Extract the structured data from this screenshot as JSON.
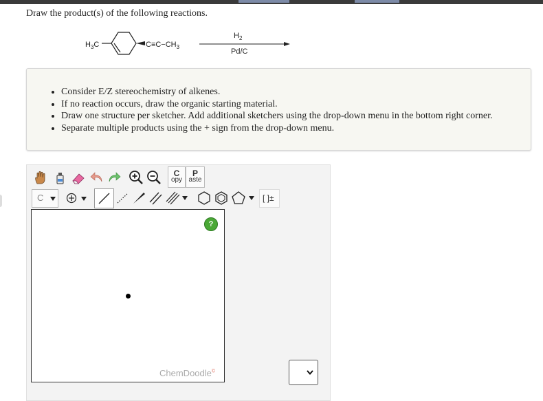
{
  "question": {
    "prompt": "Draw the product(s) of the following reactions."
  },
  "reaction": {
    "reactant_left": "H3C",
    "reactant_right": "C≡C−CH3",
    "reagent_top": "H2",
    "reagent_bottom": "Pd/C"
  },
  "instructions": [
    "Consider E/Z stereochemistry of alkenes.",
    "If no reaction occurs, draw the organic starting material.",
    "Draw one structure per sketcher. Add additional sketchers using the drop-down menu in the bottom right corner.",
    "Separate multiple products using the + sign from the drop-down menu."
  ],
  "sketcher": {
    "copy_top": "C",
    "copy_bottom": "opy",
    "paste_top": "P",
    "paste_bottom": "aste",
    "element_label": "C",
    "templates_label": "[ ]±",
    "help_label": "?",
    "brand": "ChemDoodle",
    "brand_mark": "©"
  },
  "colors": {
    "help_green": "#4aa836",
    "note_background": "#f7f7f2",
    "sketcher_background": "#f3f3f3",
    "top_bar": "#3a3a3a"
  }
}
